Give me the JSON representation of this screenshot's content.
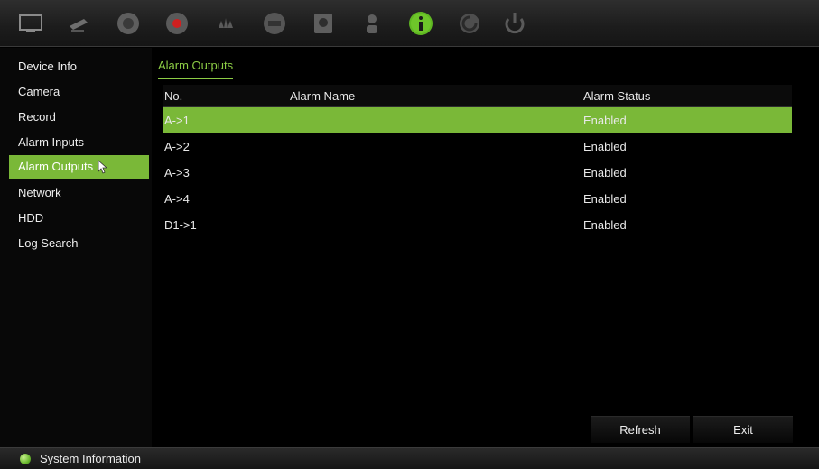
{
  "toolbar": {
    "icons": [
      {
        "name": "monitor-icon"
      },
      {
        "name": "camera-icon"
      },
      {
        "name": "playback-icon"
      },
      {
        "name": "record-icon"
      },
      {
        "name": "alarm-icon"
      },
      {
        "name": "network-icon"
      },
      {
        "name": "hdd-icon"
      },
      {
        "name": "user-icon"
      },
      {
        "name": "info-icon",
        "active": true
      },
      {
        "name": "settings-icon"
      },
      {
        "name": "power-icon"
      }
    ]
  },
  "sidebar": {
    "items": [
      {
        "label": "Device Info"
      },
      {
        "label": "Camera"
      },
      {
        "label": "Record"
      },
      {
        "label": "Alarm Inputs"
      },
      {
        "label": "Alarm Outputs",
        "active": true
      },
      {
        "label": "Network"
      },
      {
        "label": "HDD"
      },
      {
        "label": "Log Search"
      }
    ]
  },
  "main": {
    "tab_label": "Alarm Outputs",
    "table": {
      "headers": {
        "no": "No.",
        "name": "Alarm Name",
        "status": "Alarm Status"
      },
      "rows": [
        {
          "no": "A->1",
          "name": "",
          "status": "Enabled",
          "selected": true
        },
        {
          "no": "A->2",
          "name": "",
          "status": "Enabled"
        },
        {
          "no": "A->3",
          "name": "",
          "status": "Enabled"
        },
        {
          "no": "A->4",
          "name": "",
          "status": "Enabled"
        },
        {
          "no": "D1->1",
          "name": "",
          "status": "Enabled"
        }
      ]
    },
    "buttons": {
      "refresh": "Refresh",
      "exit": "Exit"
    }
  },
  "statusbar": {
    "text": "System Information"
  },
  "colors": {
    "accent": "#7ab838",
    "tab_text": "#8ccc45",
    "background": "#000000"
  }
}
